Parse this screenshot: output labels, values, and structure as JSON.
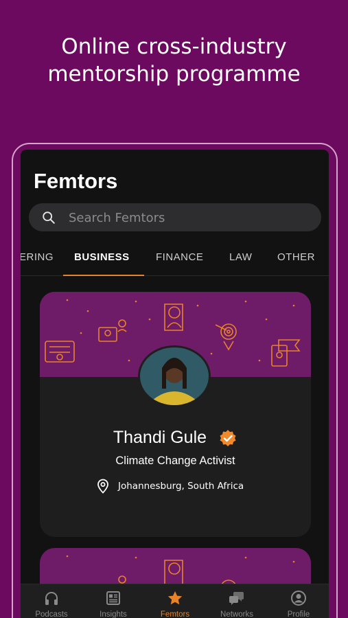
{
  "headline": {
    "line1": "Online cross-industry",
    "line2": "mentorship programme"
  },
  "app": {
    "title": "Femtors",
    "search": {
      "placeholder": "Search Femtors",
      "icon": "search-icon"
    }
  },
  "tabs": [
    {
      "label": "ERING",
      "active": false
    },
    {
      "label": "BUSINESS",
      "active": true
    },
    {
      "label": "FINANCE",
      "active": false
    },
    {
      "label": "LAW",
      "active": false
    },
    {
      "label": "OTHER",
      "active": false
    }
  ],
  "profile_card": {
    "name": "Thandi Gule",
    "role": "Climate Change Activist",
    "location": "Johannesburg, South Africa",
    "verified_icon": "verified-badge-icon",
    "location_icon": "map-pin-icon"
  },
  "bottom_nav": [
    {
      "label": "Podcasts",
      "icon": "headphones-icon",
      "active": false
    },
    {
      "label": "Insights",
      "icon": "newspaper-icon",
      "active": false
    },
    {
      "label": "Femtors",
      "icon": "star-icon",
      "active": true
    },
    {
      "label": "Networks",
      "icon": "chat-bubbles-icon",
      "active": false
    },
    {
      "label": "Profile",
      "icon": "user-circle-icon",
      "active": false
    }
  ],
  "colors": {
    "background": "#6b0a5e",
    "accent": "#e8832a",
    "banner": "#6e1b68",
    "card": "#1e1e1e",
    "screen": "#121212"
  }
}
